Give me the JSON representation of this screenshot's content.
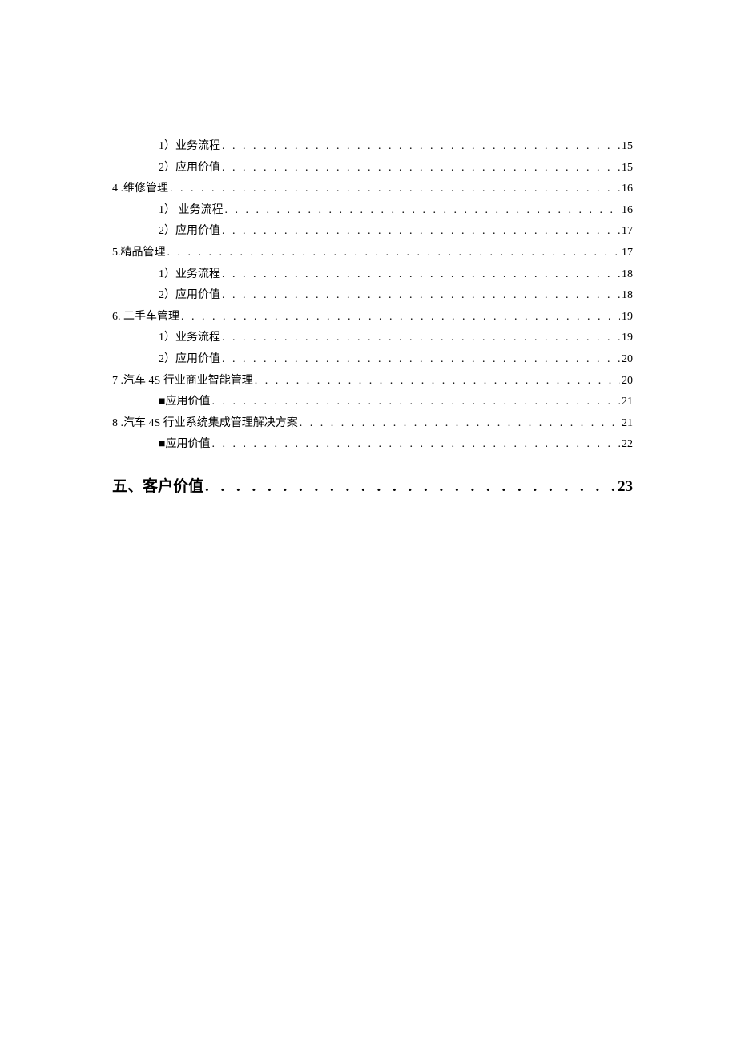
{
  "entries": [
    {
      "level": 2,
      "label": "1）业务流程",
      "page": "15"
    },
    {
      "level": 2,
      "label": "2）应用价值",
      "page": "15"
    },
    {
      "level": 1,
      "label": "4  .维修管理 ",
      "page": "16"
    },
    {
      "level": 2,
      "label": "1） 业务流程 ",
      "page": "16"
    },
    {
      "level": 2,
      "label": "2）应用价值",
      "page": "17"
    },
    {
      "level": 1,
      "label": "5.精品管理",
      "page": "17"
    },
    {
      "level": 2,
      "label": "1）业务流程",
      "page": "18"
    },
    {
      "level": 2,
      "label": "2）应用价值",
      "page": "18"
    },
    {
      "level": 1,
      "label": "6.  二手车管理 ",
      "page": "19"
    },
    {
      "level": 2,
      "label": "1）业务流程",
      "page": "19"
    },
    {
      "level": 2,
      "label": "2）应用价值",
      "page": "20"
    },
    {
      "level": 1,
      "label": "7  .汽车 4S 行业商业智能管理",
      "page": "20"
    },
    {
      "level": 2,
      "label": "■应用价值",
      "page": "21"
    },
    {
      "level": 1,
      "label": "8  .汽车 4S 行业系统集成管理解决方案",
      "page": "21"
    },
    {
      "level": 2,
      "label": "■应用价值",
      "page": "22"
    },
    {
      "level": 0,
      "label": "五、客户价值 ",
      "page": " 23",
      "heading": true
    }
  ]
}
